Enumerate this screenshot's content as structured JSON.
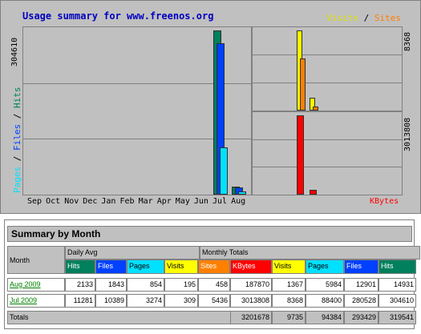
{
  "chart": {
    "title": "Usage summary for www.freenos.org",
    "legend_visits": "Visits",
    "legend_sep": " / ",
    "legend_sites": "Sites",
    "left_legend_pages": "Pages",
    "left_legend_files": "Files",
    "left_legend_hits": "Hits",
    "left_legend_sep": " / ",
    "left_max": "304610",
    "right_top_max": "8368",
    "right_bottom_max": "3013808",
    "kbytes_label": "KBytes",
    "colors": {
      "hits": "#00805c",
      "files": "#0040ff",
      "pages": "#00e0ff",
      "visits": "#ffff00",
      "sites": "#ff8000",
      "kbytes": "#ff0000"
    }
  },
  "chart_data": {
    "type": "bar",
    "categories": [
      "Sep",
      "Oct",
      "Nov",
      "Dec",
      "Jan",
      "Feb",
      "Mar",
      "Apr",
      "May",
      "Jun",
      "Jul",
      "Aug"
    ],
    "series": [
      {
        "name": "Hits",
        "values": [
          0,
          0,
          0,
          0,
          0,
          0,
          0,
          0,
          0,
          0,
          304610,
          14931
        ]
      },
      {
        "name": "Files",
        "values": [
          0,
          0,
          0,
          0,
          0,
          0,
          0,
          0,
          0,
          0,
          280528,
          12901
        ]
      },
      {
        "name": "Pages",
        "values": [
          0,
          0,
          0,
          0,
          0,
          0,
          0,
          0,
          0,
          0,
          88400,
          5984
        ]
      },
      {
        "name": "Visits",
        "values": [
          0,
          0,
          0,
          0,
          0,
          0,
          0,
          0,
          0,
          0,
          8368,
          1367
        ]
      },
      {
        "name": "Sites",
        "values": [
          0,
          0,
          0,
          0,
          0,
          0,
          0,
          0,
          0,
          0,
          5436,
          458
        ]
      },
      {
        "name": "KBytes",
        "values": [
          0,
          0,
          0,
          0,
          0,
          0,
          0,
          0,
          0,
          0,
          3013808,
          187870
        ]
      }
    ]
  },
  "summary": {
    "title": "Summary by Month",
    "month_header": "Month",
    "daily_avg_header": "Daily Avg",
    "monthly_totals_header": "Monthly Totals",
    "daily_cols": [
      "Hits",
      "Files",
      "Pages",
      "Visits"
    ],
    "monthly_cols": [
      "Sites",
      "KBytes",
      "Visits",
      "Pages",
      "Files",
      "Hits"
    ],
    "rows": [
      {
        "month": "Aug 2009",
        "daily": [
          "2133",
          "1843",
          "854",
          "195"
        ],
        "monthly": [
          "458",
          "187870",
          "1367",
          "5984",
          "12901",
          "14931"
        ]
      },
      {
        "month": "Jul 2009",
        "daily": [
          "11281",
          "10389",
          "3274",
          "309"
        ],
        "monthly": [
          "5436",
          "3013808",
          "8368",
          "88400",
          "280528",
          "304610"
        ]
      }
    ],
    "totals_label": "Totals",
    "totals": [
      "3201678",
      "9735",
      "94384",
      "293429",
      "319541"
    ]
  }
}
